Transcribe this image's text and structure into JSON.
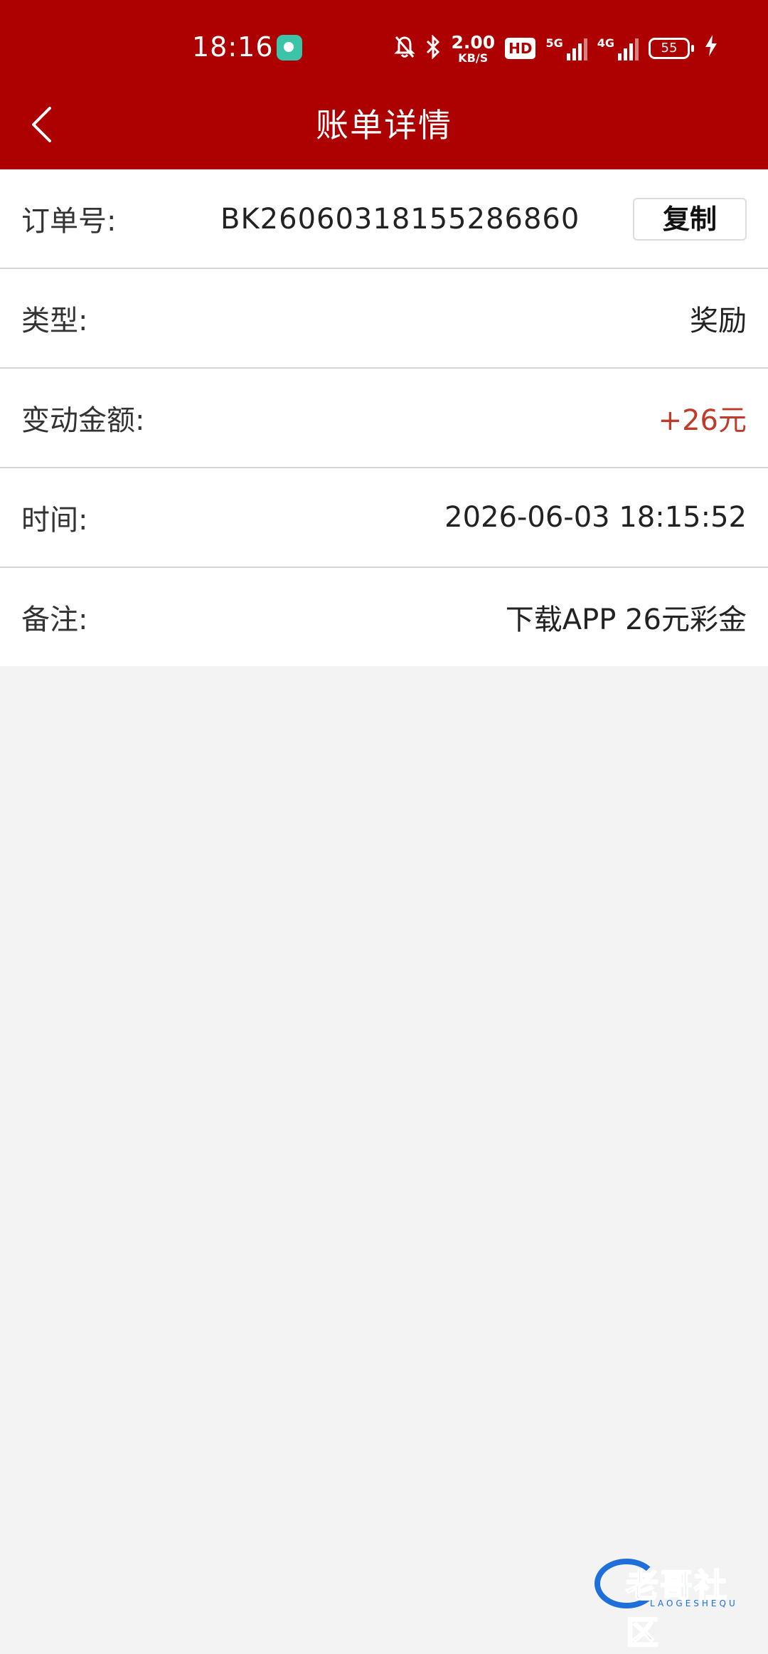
{
  "status_bar": {
    "time": "18:16",
    "network_speed": "2.00",
    "network_speed_unit": "KB/S",
    "hd_badge": "HD",
    "sim1_network": "5G",
    "sim2_network": "4G",
    "battery_level": "55"
  },
  "header": {
    "title": "账单详情"
  },
  "details": {
    "order": {
      "label": "订单号:",
      "value": "BK26060318155286860",
      "copy_label": "复制"
    },
    "type": {
      "label": "类型:",
      "value": "奖励"
    },
    "amount": {
      "label": "变动金额:",
      "value": "+26元"
    },
    "time": {
      "label": "时间:",
      "value": "2026-06-03 18:15:52"
    },
    "remark": {
      "label": "备注:",
      "value": "下载APP 26元彩金"
    }
  },
  "watermark": {
    "text": "老哥社区",
    "subtext": "LAOGESHEQU"
  },
  "colors": {
    "brand": "#ad0000",
    "amount": "#c0392b",
    "background": "#f3f3f3"
  }
}
